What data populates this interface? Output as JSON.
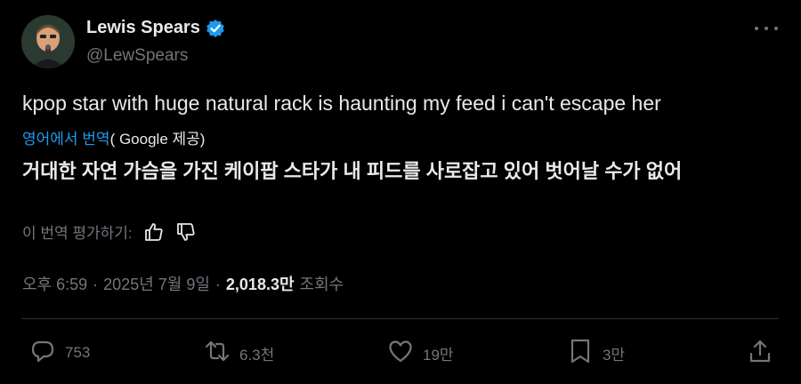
{
  "author": {
    "name": "Lewis Spears",
    "handle": "@LewSpears",
    "verified": true,
    "verified_color": "#1d9bf0"
  },
  "tweet": {
    "text": "kpop star with huge natural rack is haunting my feed i can't escape her",
    "translate_link": "영어에서 번역",
    "translate_by": "( Google 제공)",
    "translated_text": "거대한 자연 가슴을 가진 케이팝 스타가 내 피드를 사로잡고 있어 벗어날 수가 없어"
  },
  "rate_translation": {
    "label": "이 번역 평가하기:",
    "thumbs_up_icon": "thumbs-up-icon",
    "thumbs_down_icon": "thumbs-down-icon"
  },
  "meta": {
    "time": "오후 6:59",
    "date": "2025년 7월 9일",
    "separator": "·",
    "views_count": "2,018.3만",
    "views_label": "조회수"
  },
  "actions": {
    "reply_count": "753",
    "retweet_count": "6.3천",
    "like_count": "19만",
    "bookmark_count": "3만"
  },
  "colors": {
    "background": "#000000",
    "text_primary": "#e7e9ea",
    "text_secondary": "#71767b",
    "link": "#1d9bf0",
    "divider": "#2f3336"
  }
}
